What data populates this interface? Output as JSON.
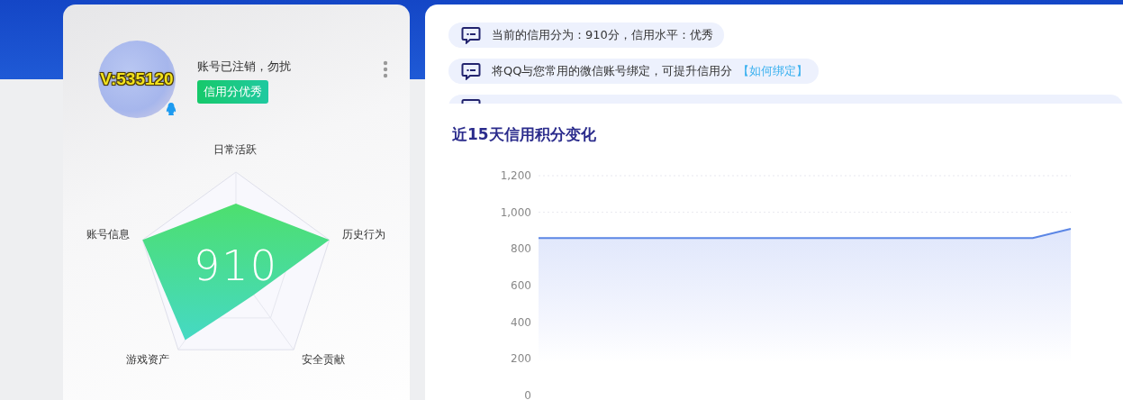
{
  "profile": {
    "avatar_badge": "V:535120",
    "status": "账号已注销，勿扰",
    "credit_tag": "信用分优秀"
  },
  "radar": {
    "score": "910",
    "axes": [
      "日常活跃",
      "历史行为",
      "安全贡献",
      "游戏资产",
      "账号信息"
    ]
  },
  "notices": [
    {
      "kind": "full",
      "text": "当前的信用分为：910分，信用水平：优秀"
    },
    {
      "kind": "full",
      "text": "将QQ与您常用的微信账号绑定，可提升信用分",
      "link": "【如何绑定】"
    },
    {
      "kind": "clipped"
    }
  ],
  "trend": {
    "title": "近15天信用积分变化",
    "chart_data": {
      "type": "area",
      "values": [
        860,
        860,
        860,
        860,
        860,
        860,
        860,
        860,
        860,
        860,
        860,
        860,
        860,
        860,
        910
      ],
      "ylim": [
        0,
        1200
      ],
      "yticks": [
        {
          "value": 0,
          "label": "0"
        },
        {
          "value": 200,
          "label": "200"
        },
        {
          "value": 400,
          "label": "400"
        },
        {
          "value": 600,
          "label": "600"
        },
        {
          "value": 800,
          "label": "800"
        },
        {
          "value": 1000,
          "label": "1,000"
        },
        {
          "value": 1200,
          "label": "1,200"
        }
      ]
    }
  }
}
